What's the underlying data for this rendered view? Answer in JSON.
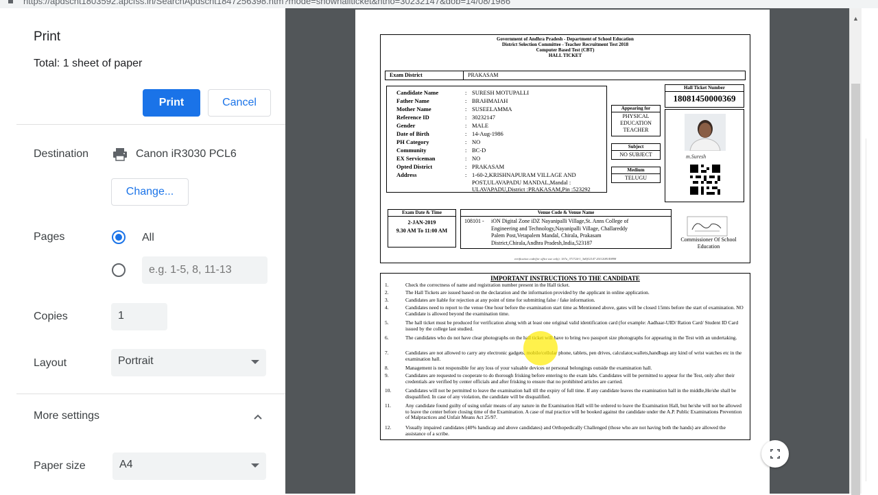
{
  "browser": {
    "url": "https://apdscht1803592.apcfss.in/SearchApdscht1847256398.htm?mode=showhallticket&htno=30232147&dob=14/08/1986"
  },
  "print_dialog": {
    "title": "Print",
    "total": "Total: 1 sheet of paper",
    "print_label": "Print",
    "cancel_label": "Cancel",
    "destination_label": "Destination",
    "destination_value": "Canon iR3030 PCL6",
    "change_label": "Change...",
    "pages_label": "Pages",
    "pages_all": "All",
    "pages_custom_placeholder": "e.g. 1-5, 8, 11-13",
    "copies_label": "Copies",
    "copies_value": "1",
    "layout_label": "Layout",
    "layout_value": "Portrait",
    "more_settings": "More settings",
    "paper_size_label": "Paper size",
    "paper_size_value": "A4"
  },
  "hall_ticket": {
    "header": [
      "Government of Andhra Pradesh - Department of School Education",
      "District Selection Committee - Teacher Recruitment Test 2018",
      "Computer Based Test (CBT)",
      "HALL TICKET"
    ],
    "exam_district_label": "Exam District",
    "exam_district_value": "PRAKASAM",
    "fields": [
      {
        "k": "Candidate Name",
        "v": "SURESH MOTUPALLI"
      },
      {
        "k": "Father Name",
        "v": "BRAHMAIAH"
      },
      {
        "k": "Mother Name",
        "v": "SUSEELAMMA"
      },
      {
        "k": "Reference ID",
        "v": "30232147"
      },
      {
        "k": "Gender",
        "v": "MALE"
      },
      {
        "k": "Date of Birth",
        "v": "14-Aug-1986"
      },
      {
        "k": "PH Category",
        "v": "NO"
      },
      {
        "k": "Community",
        "v": "BC-D"
      },
      {
        "k": "EX Serviceman",
        "v": "NO"
      },
      {
        "k": "Opted District",
        "v": "PRAKASAM"
      },
      {
        "k": "Address",
        "v": "1-60-2,KRISHNAPURAM VILLAGE AND"
      }
    ],
    "address_line2": "POST,ULAVAPADU MANDAL,Mandal :",
    "address_line3": "ULAVAPADU,District :PRAKASAM,Pin :523292",
    "appearing_for_label": "Appearing for",
    "appearing_for_value": "PHYSICAL EDUCATION TEACHER",
    "subject_label": "Subject",
    "subject_value": "NO SUBJECT",
    "medium_label": "Medium",
    "medium_value": "TELUGU",
    "ht_number_label": "Hall Ticket Number",
    "ht_number_value": "18081450000369",
    "signature_text": "m.Suresh",
    "exam_dt_label": "Exam Date & Time",
    "exam_date": "2-JAN-2019",
    "exam_time": "9.30 AM To 11:00 AM",
    "venue_label": "Venue Code & Venue Name",
    "venue_code": "108101 -",
    "venue_lines": [
      "iON Digital Zone iDZ Nayanipalli Village,St. Anns College of",
      "Engineering and Technology,Nayanipalli Village, Challareddy",
      "Palem Post,Vetapalem Mandal, Chirala, Prakasam",
      "District,Chirala,Andhra Pradesh,India,523187"
    ],
    "commissioner": "Commissioner Of School Education",
    "verification": "verification code(for office use only): 1b7a_37172d-1_3d0f12147 2011208149898",
    "instructions_title": "IMPORTANT INSTRUCTIONS TO THE CANDIDATE",
    "instructions": [
      {
        "n": "1.",
        "t": "Check the correctness of name and registration number present in the Hall ticket."
      },
      {
        "n": "2.",
        "t": "The Hall Tickets are issued based on the declaration and the information provided by the applicant in online application."
      },
      {
        "n": "3.",
        "t": "Candidates are liable for rejection at any point of time for submitting false / fake information."
      },
      {
        "n": "4.",
        "t": "Candidates need to report to the venue One hour before the examination start time as Mentioned above, gates will be closed 15mts before the start of examination. NO Candidate is allowed beyond the examination time."
      },
      {
        "n": "5.",
        "t": "The hall ticket must be produced for verification along with at least one original valid identification card (for example: Aadhaar-UID/ Ration Card/ Student ID Card issued by the college last studied."
      },
      {
        "n": "6.",
        "t": "The candidates who do not have clear photographs on the hall ticket will have to bring two passport size photographs for appearing in the Test with an undertaking."
      },
      {
        "n": "7.",
        "t": "Candidates are not allowed to carry any electronic gadgets, mobile/cellular phone, tablets, pen drives, calculator,wallets,handbags any kind of wrist watches etc in the examination hall."
      },
      {
        "n": "8.",
        "t": "Management is not responsible for any loss of your valuable devices or personal belongings outside the examination hall."
      },
      {
        "n": "9.",
        "t": "Candidates are requested to cooperate to do thorough frisking before entering to the exam labs. Candidates will be permitted to appear for the Test, only after their credentials are verified by center officials and after frisking to ensure that no prohibited articles are carried."
      },
      {
        "n": "10.",
        "t": "Candidates will not be permitted to leave the examination hall till the expiry of full time. If any candidate leaves the examination hall in the middle,He/she shall be disqualified. In case of any violation, the candidate will be disqualified."
      },
      {
        "n": "11.",
        "t": "Any candidate found guilty of using unfair means of any nature in the Examination Hall will be ordered to leave the Examination Hall, but he/she will not be allowed to leave the center before closing time of the Examination. A case of mal practice will be booked against the candidate under the A.P. Public Examinations Prevention of Malpractices and Unfair Means Act 25/97."
      },
      {
        "n": "12.",
        "t": "Visually impaired candidates (40% handicap and above candidates) and Orthopedically Challenged (those who are not having both the hands) are allowed the assistance of a scribe."
      }
    ]
  }
}
